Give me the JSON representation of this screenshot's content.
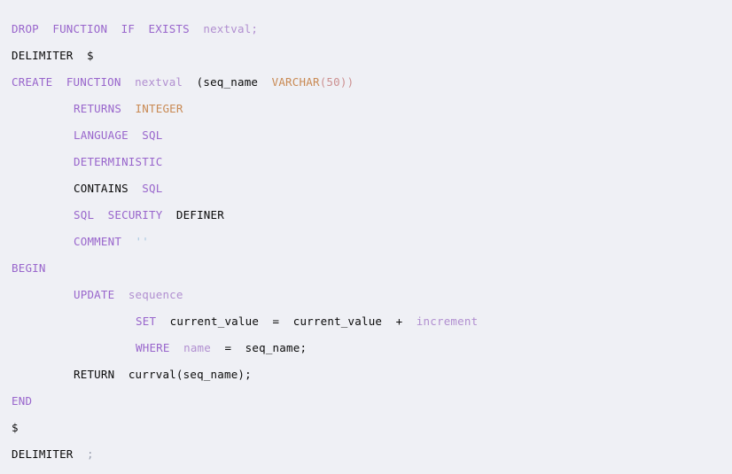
{
  "document": {
    "kind": "sql-code-listing",
    "background_color": "#eff0f5",
    "palette": {
      "keyword": "#9966cc",
      "identifier": "#b18fd0",
      "datatype": "#c98a54",
      "number": "#cc9090",
      "string": "#a8c8e0",
      "plain": "#0b0b0b",
      "punctuation": "#9aa0b0"
    },
    "lines": [
      {
        "indent": 0,
        "tokens": [
          {
            "text": "DROP",
            "type": "kw"
          },
          {
            "text": "  ",
            "type": "plain"
          },
          {
            "text": "FUNCTION",
            "type": "kw"
          },
          {
            "text": "  ",
            "type": "plain"
          },
          {
            "text": "IF",
            "type": "kw"
          },
          {
            "text": "  ",
            "type": "plain"
          },
          {
            "text": "EXISTS",
            "type": "kw"
          },
          {
            "text": "  ",
            "type": "plain"
          },
          {
            "text": "nextval;",
            "type": "ident"
          }
        ]
      },
      {
        "indent": 0,
        "tokens": [
          {
            "text": "DELIMITER",
            "type": "plain"
          },
          {
            "text": "  ",
            "type": "plain"
          },
          {
            "text": "$",
            "type": "plain"
          }
        ]
      },
      {
        "indent": 0,
        "tokens": [
          {
            "text": "CREATE",
            "type": "kw"
          },
          {
            "text": "  ",
            "type": "plain"
          },
          {
            "text": "FUNCTION",
            "type": "kw"
          },
          {
            "text": "  ",
            "type": "plain"
          },
          {
            "text": "nextval",
            "type": "ident"
          },
          {
            "text": "  ",
            "type": "plain"
          },
          {
            "text": "(seq_name",
            "type": "plain"
          },
          {
            "text": "  ",
            "type": "plain"
          },
          {
            "text": "VARCHAR",
            "type": "type"
          },
          {
            "text": "(50))",
            "type": "num"
          }
        ]
      },
      {
        "indent": 4,
        "tokens": [
          {
            "text": "RETURNS",
            "type": "kw"
          },
          {
            "text": "  ",
            "type": "plain"
          },
          {
            "text": "INTEGER",
            "type": "type"
          }
        ]
      },
      {
        "indent": 4,
        "tokens": [
          {
            "text": "LANGUAGE",
            "type": "kw"
          },
          {
            "text": "  ",
            "type": "plain"
          },
          {
            "text": "SQL",
            "type": "kw"
          }
        ]
      },
      {
        "indent": 4,
        "tokens": [
          {
            "text": "DETERMINISTIC",
            "type": "kw"
          }
        ]
      },
      {
        "indent": 4,
        "tokens": [
          {
            "text": "CONTAINS",
            "type": "plain"
          },
          {
            "text": "  ",
            "type": "plain"
          },
          {
            "text": "SQL",
            "type": "kw"
          }
        ]
      },
      {
        "indent": 4,
        "tokens": [
          {
            "text": "SQL",
            "type": "kw"
          },
          {
            "text": "  ",
            "type": "plain"
          },
          {
            "text": "SECURITY",
            "type": "kw"
          },
          {
            "text": "  ",
            "type": "plain"
          },
          {
            "text": "DEFINER",
            "type": "plain"
          }
        ]
      },
      {
        "indent": 4,
        "tokens": [
          {
            "text": "COMMENT",
            "type": "kw"
          },
          {
            "text": "  ",
            "type": "plain"
          },
          {
            "text": "''",
            "type": "str"
          }
        ]
      },
      {
        "indent": 0,
        "tokens": [
          {
            "text": "BEGIN",
            "type": "kw"
          }
        ]
      },
      {
        "indent": 4,
        "tokens": [
          {
            "text": "UPDATE",
            "type": "kw"
          },
          {
            "text": "  ",
            "type": "plain"
          },
          {
            "text": "sequence",
            "type": "ident"
          }
        ]
      },
      {
        "indent": 8,
        "tokens": [
          {
            "text": "SET",
            "type": "kw"
          },
          {
            "text": "  ",
            "type": "plain"
          },
          {
            "text": "current_value",
            "type": "plain"
          },
          {
            "text": "  =  ",
            "type": "plain"
          },
          {
            "text": "current_value",
            "type": "plain"
          },
          {
            "text": "  +  ",
            "type": "plain"
          },
          {
            "text": "increment",
            "type": "ident"
          }
        ]
      },
      {
        "indent": 8,
        "tokens": [
          {
            "text": "WHERE",
            "type": "kw"
          },
          {
            "text": "  ",
            "type": "plain"
          },
          {
            "text": "name",
            "type": "ident"
          },
          {
            "text": "  =  ",
            "type": "plain"
          },
          {
            "text": "seq_name;",
            "type": "plain"
          }
        ]
      },
      {
        "indent": 4,
        "tokens": [
          {
            "text": "RETURN",
            "type": "plain"
          },
          {
            "text": "  ",
            "type": "plain"
          },
          {
            "text": "currval(seq_name);",
            "type": "plain"
          }
        ]
      },
      {
        "indent": 0,
        "tokens": [
          {
            "text": "END",
            "type": "kw"
          }
        ]
      },
      {
        "indent": 0,
        "tokens": [
          {
            "text": "$",
            "type": "plain"
          }
        ]
      },
      {
        "indent": 0,
        "tokens": [
          {
            "text": "DELIMITER",
            "type": "plain"
          },
          {
            "text": "  ",
            "type": "plain"
          },
          {
            "text": ";",
            "type": "punct"
          }
        ]
      }
    ]
  }
}
